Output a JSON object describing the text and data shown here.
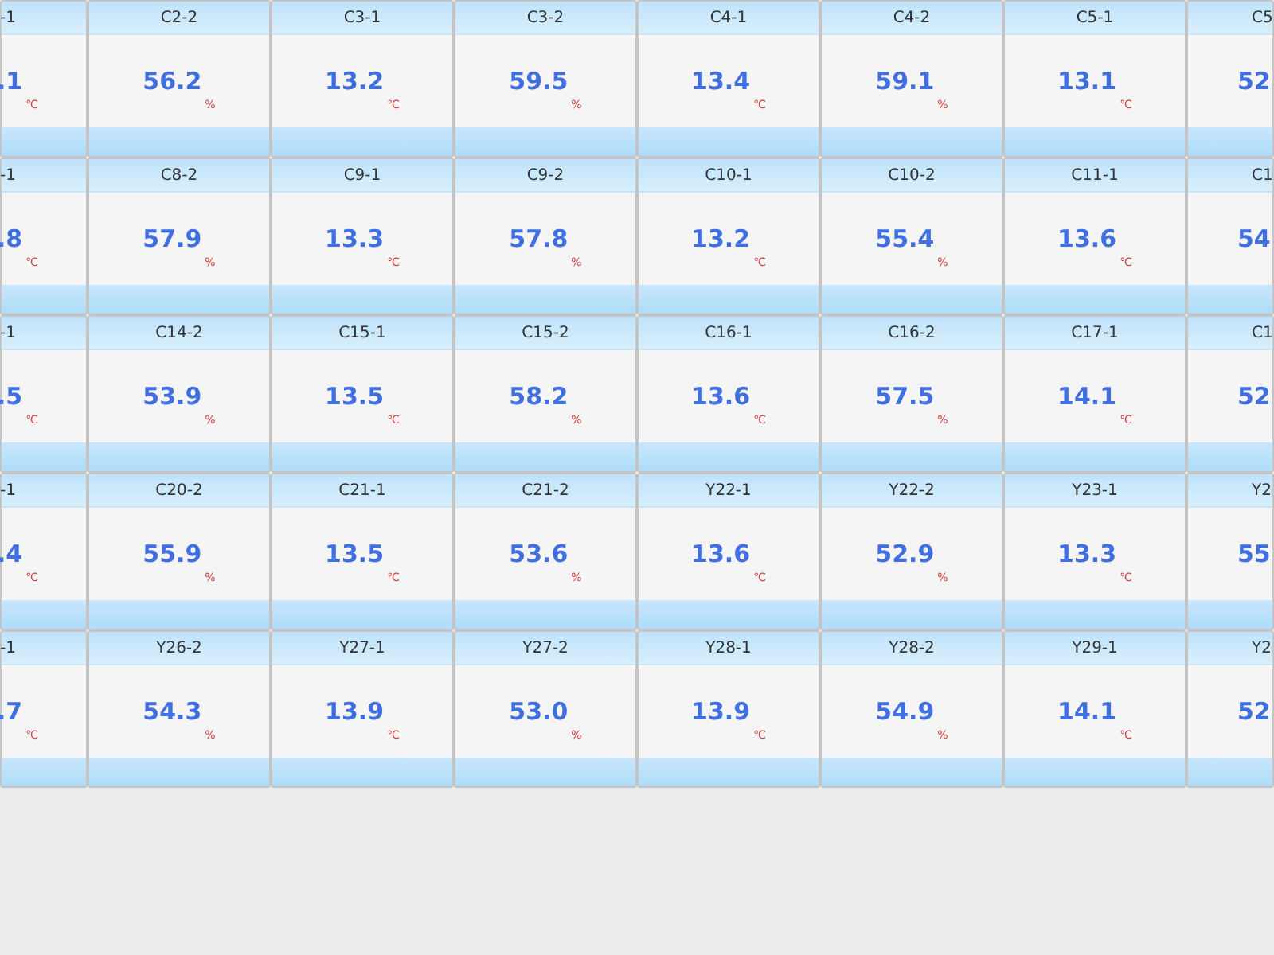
{
  "rows": [
    {
      "cells": [
        {
          "label": "-1",
          "value": ".1",
          "unit": "℃"
        },
        {
          "label": "C2-2",
          "value": "56.2",
          "unit": "%"
        },
        {
          "label": "C3-1",
          "value": "13.2",
          "unit": "℃"
        },
        {
          "label": "C3-2",
          "value": "59.5",
          "unit": "%"
        },
        {
          "label": "C4-1",
          "value": "13.4",
          "unit": "℃"
        },
        {
          "label": "C4-2",
          "value": "59.1",
          "unit": "%"
        },
        {
          "label": "C5-1",
          "value": "13.1",
          "unit": "℃"
        },
        {
          "label": "C5",
          "value": "52"
        }
      ]
    },
    {
      "cells": [
        {
          "label": "-1",
          "value": ".8",
          "unit": "℃"
        },
        {
          "label": "C8-2",
          "value": "57.9",
          "unit": "%"
        },
        {
          "label": "C9-1",
          "value": "13.3",
          "unit": "℃"
        },
        {
          "label": "C9-2",
          "value": "57.8",
          "unit": "%"
        },
        {
          "label": "C10-1",
          "value": "13.2",
          "unit": "℃"
        },
        {
          "label": "C10-2",
          "value": "55.4",
          "unit": "%"
        },
        {
          "label": "C11-1",
          "value": "13.6",
          "unit": "℃"
        },
        {
          "label": "C1",
          "value": "54"
        }
      ]
    },
    {
      "cells": [
        {
          "label": "-1",
          "value": ".5",
          "unit": "℃"
        },
        {
          "label": "C14-2",
          "value": "53.9",
          "unit": "%"
        },
        {
          "label": "C15-1",
          "value": "13.5",
          "unit": "℃"
        },
        {
          "label": "C15-2",
          "value": "58.2",
          "unit": "%"
        },
        {
          "label": "C16-1",
          "value": "13.6",
          "unit": "℃"
        },
        {
          "label": "C16-2",
          "value": "57.5",
          "unit": "%"
        },
        {
          "label": "C17-1",
          "value": "14.1",
          "unit": "℃"
        },
        {
          "label": "C1",
          "value": "52"
        }
      ]
    },
    {
      "cells": [
        {
          "label": "-1",
          "value": ".4",
          "unit": "℃"
        },
        {
          "label": "C20-2",
          "value": "55.9",
          "unit": "%"
        },
        {
          "label": "C21-1",
          "value": "13.5",
          "unit": "℃"
        },
        {
          "label": "C21-2",
          "value": "53.6",
          "unit": "%"
        },
        {
          "label": "Y22-1",
          "value": "13.6",
          "unit": "℃"
        },
        {
          "label": "Y22-2",
          "value": "52.9",
          "unit": "%"
        },
        {
          "label": "Y23-1",
          "value": "13.3",
          "unit": "℃"
        },
        {
          "label": "Y2",
          "value": "55"
        }
      ]
    },
    {
      "cells": [
        {
          "label": "-1",
          "value": ".7",
          "unit": "℃"
        },
        {
          "label": "Y26-2",
          "value": "54.3",
          "unit": "%"
        },
        {
          "label": "Y27-1",
          "value": "13.9",
          "unit": "℃"
        },
        {
          "label": "Y27-2",
          "value": "53.0",
          "unit": "%"
        },
        {
          "label": "Y28-1",
          "value": "13.9",
          "unit": "℃"
        },
        {
          "label": "Y28-2",
          "value": "54.9",
          "unit": "%"
        },
        {
          "label": "Y29-1",
          "value": "14.1",
          "unit": "℃"
        },
        {
          "label": "Y2",
          "value": "52"
        }
      ]
    }
  ]
}
